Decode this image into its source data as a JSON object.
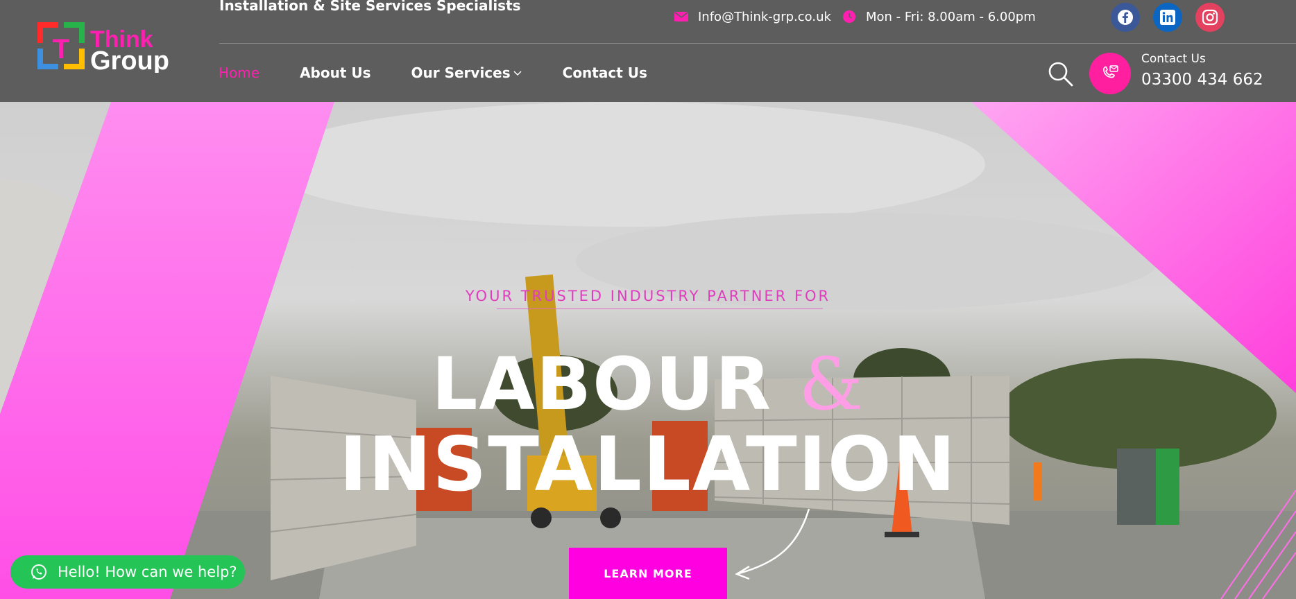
{
  "header": {
    "logo": {
      "line1": "Think",
      "line2": "Group",
      "letter": "T"
    },
    "tagline": "Installation & Site Services Specialists",
    "email": {
      "icon": "mail-icon",
      "text": "Info@Think-grp.co.uk"
    },
    "hours": {
      "icon": "clock-icon",
      "text": "Mon - Fri: 8.00am - 6.00pm"
    },
    "social": [
      {
        "name": "facebook",
        "icon": "facebook-icon",
        "color": "#3b5998"
      },
      {
        "name": "linkedin",
        "icon": "linkedin-icon",
        "color": "#0a66c2"
      },
      {
        "name": "instagram",
        "icon": "instagram-icon",
        "color": "#e4405f"
      }
    ],
    "nav": [
      {
        "label": "Home",
        "active": true
      },
      {
        "label": "About Us",
        "active": false
      },
      {
        "label": "Our Services",
        "active": false,
        "has_dropdown": true
      },
      {
        "label": "Contact Us",
        "active": false
      }
    ],
    "contact": {
      "label": "Contact Us",
      "phone": "03300 434 662"
    }
  },
  "hero": {
    "overline": "YOUR TRUSTED INDUSTRY PARTNER FOR",
    "headline_word1": "LABOUR",
    "headline_amp": "&",
    "headline_word2": "INSTALLATION",
    "button_label": "LEARN MORE"
  },
  "whatsapp": {
    "icon": "whatsapp-icon",
    "text": "Hello! How can we help?"
  },
  "colors": {
    "header_bg": "#5d5d5d",
    "accent_pink": "#ff1fb0",
    "hero_pink": "#ff5ce8",
    "button_magenta": "#ff00e0",
    "whatsapp_green": "#25c457"
  }
}
